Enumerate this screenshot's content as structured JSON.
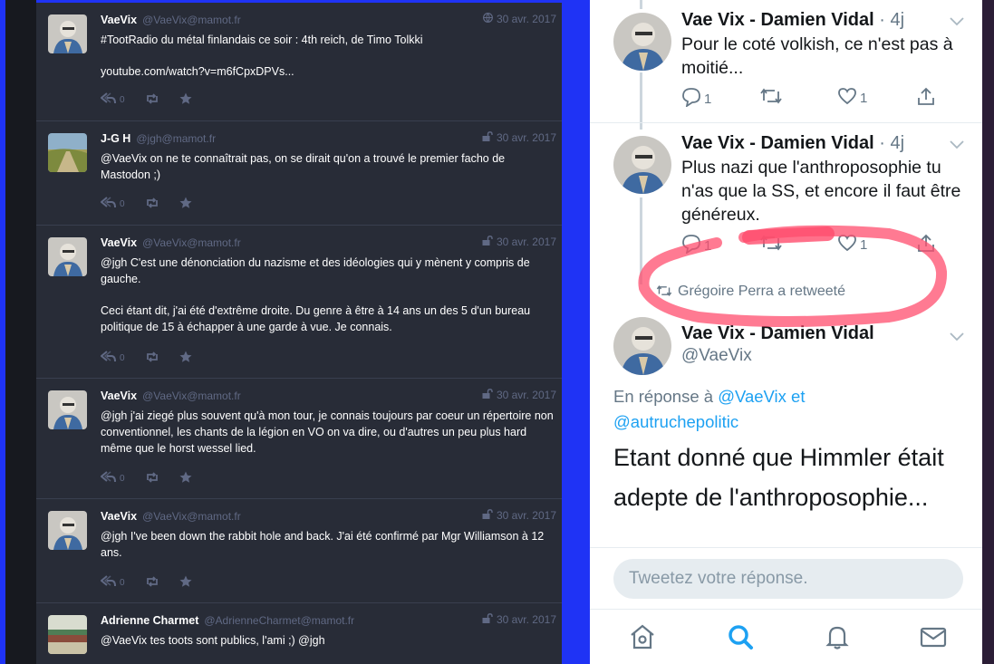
{
  "mastodon": {
    "toots": [
      {
        "display_name": "VaeVix",
        "account": "@VaeVix@mamot.fr",
        "visibility_icon": "globe-icon",
        "time": "30 avr. 2017",
        "paragraphs": [
          "#TootRadio du métal finlandais ce soir : 4th reich, de Timo Tolkki",
          "youtube.com/watch?v=m6fCpxDPVs..."
        ],
        "reply_count": "0"
      },
      {
        "display_name": "J-G H",
        "account": "@jgh@mamot.fr",
        "visibility_icon": "unlock-icon",
        "time": "30 avr. 2017",
        "paragraphs": [
          "@VaeVix on ne te connaîtrait pas, on se dirait qu'on a trouvé le premier facho de Mastodon ;)"
        ],
        "reply_count": "0"
      },
      {
        "display_name": "VaeVix",
        "account": "@VaeVix@mamot.fr",
        "visibility_icon": "unlock-icon",
        "time": "30 avr. 2017",
        "paragraphs": [
          "@jgh C'est une dénonciation du nazisme et des idéologies qui y mènent y compris de gauche.",
          "Ceci étant dit, j'ai été d'extrême droite. Du genre à être à 14 ans un des 5 d'un bureau politique de 15 à échapper à une garde à vue. Je connais."
        ],
        "reply_count": "0"
      },
      {
        "display_name": "VaeVix",
        "account": "@VaeVix@mamot.fr",
        "visibility_icon": "unlock-icon",
        "time": "30 avr. 2017",
        "paragraphs": [
          "@jgh j'ai ziegé plus souvent qu'à mon tour, je connais toujours par coeur un répertoire non conventionnel, les chants de la légion en VO on va dire, ou d'autres un peu plus hard même que le horst wessel lied."
        ],
        "reply_count": "0"
      },
      {
        "display_name": "VaeVix",
        "account": "@VaeVix@mamot.fr",
        "visibility_icon": "unlock-icon",
        "time": "30 avr. 2017",
        "paragraphs": [
          "@jgh I've been down the rabbit hole and back. J'ai été confirmé par Mgr Williamson à 12 ans."
        ],
        "reply_count": "0"
      },
      {
        "display_name": "Adrienne Charmet",
        "account": "@AdrienneCharmet@mamot.fr",
        "visibility_icon": "unlock-icon",
        "time": "30 avr. 2017",
        "paragraphs": [
          "@VaeVix tes toots sont publics, l'ami ;) @jgh"
        ],
        "reply_count": ""
      }
    ]
  },
  "twitter": {
    "tweets": [
      {
        "name": "Vae Vix - Damien Vidal",
        "ago": "· 4j",
        "text": "Pour le coté volkish, ce n'est pas à moitié...",
        "replies": "1",
        "likes": "1"
      },
      {
        "name": "Vae Vix - Damien Vidal",
        "ago": "· 4j",
        "text": "Plus nazi que l'anthroposophie tu n'as que la SS, et encore il faut être généreux.",
        "replies": "1",
        "likes": "1"
      }
    ],
    "retweeted_by": "Grégoire Perra a retweeté",
    "main": {
      "name": "Vae Vix - Damien Vidal",
      "handle": "@VaeVix",
      "reply_prefix": "En réponse à",
      "reply_user1": "@VaeVix",
      "reply_and": "et",
      "reply_user2": "@autruchepolitic",
      "text": "Etant donné que Himmler était adepte de l'anthroposophie..."
    },
    "reply_placeholder": "Tweetez votre réponse.",
    "tabs": [
      "home-icon",
      "search-icon",
      "notifications-bell-icon",
      "messages-envelope-icon"
    ],
    "active_tab_color": "#1da1f2",
    "highlight_color": "#ff4d6d"
  }
}
